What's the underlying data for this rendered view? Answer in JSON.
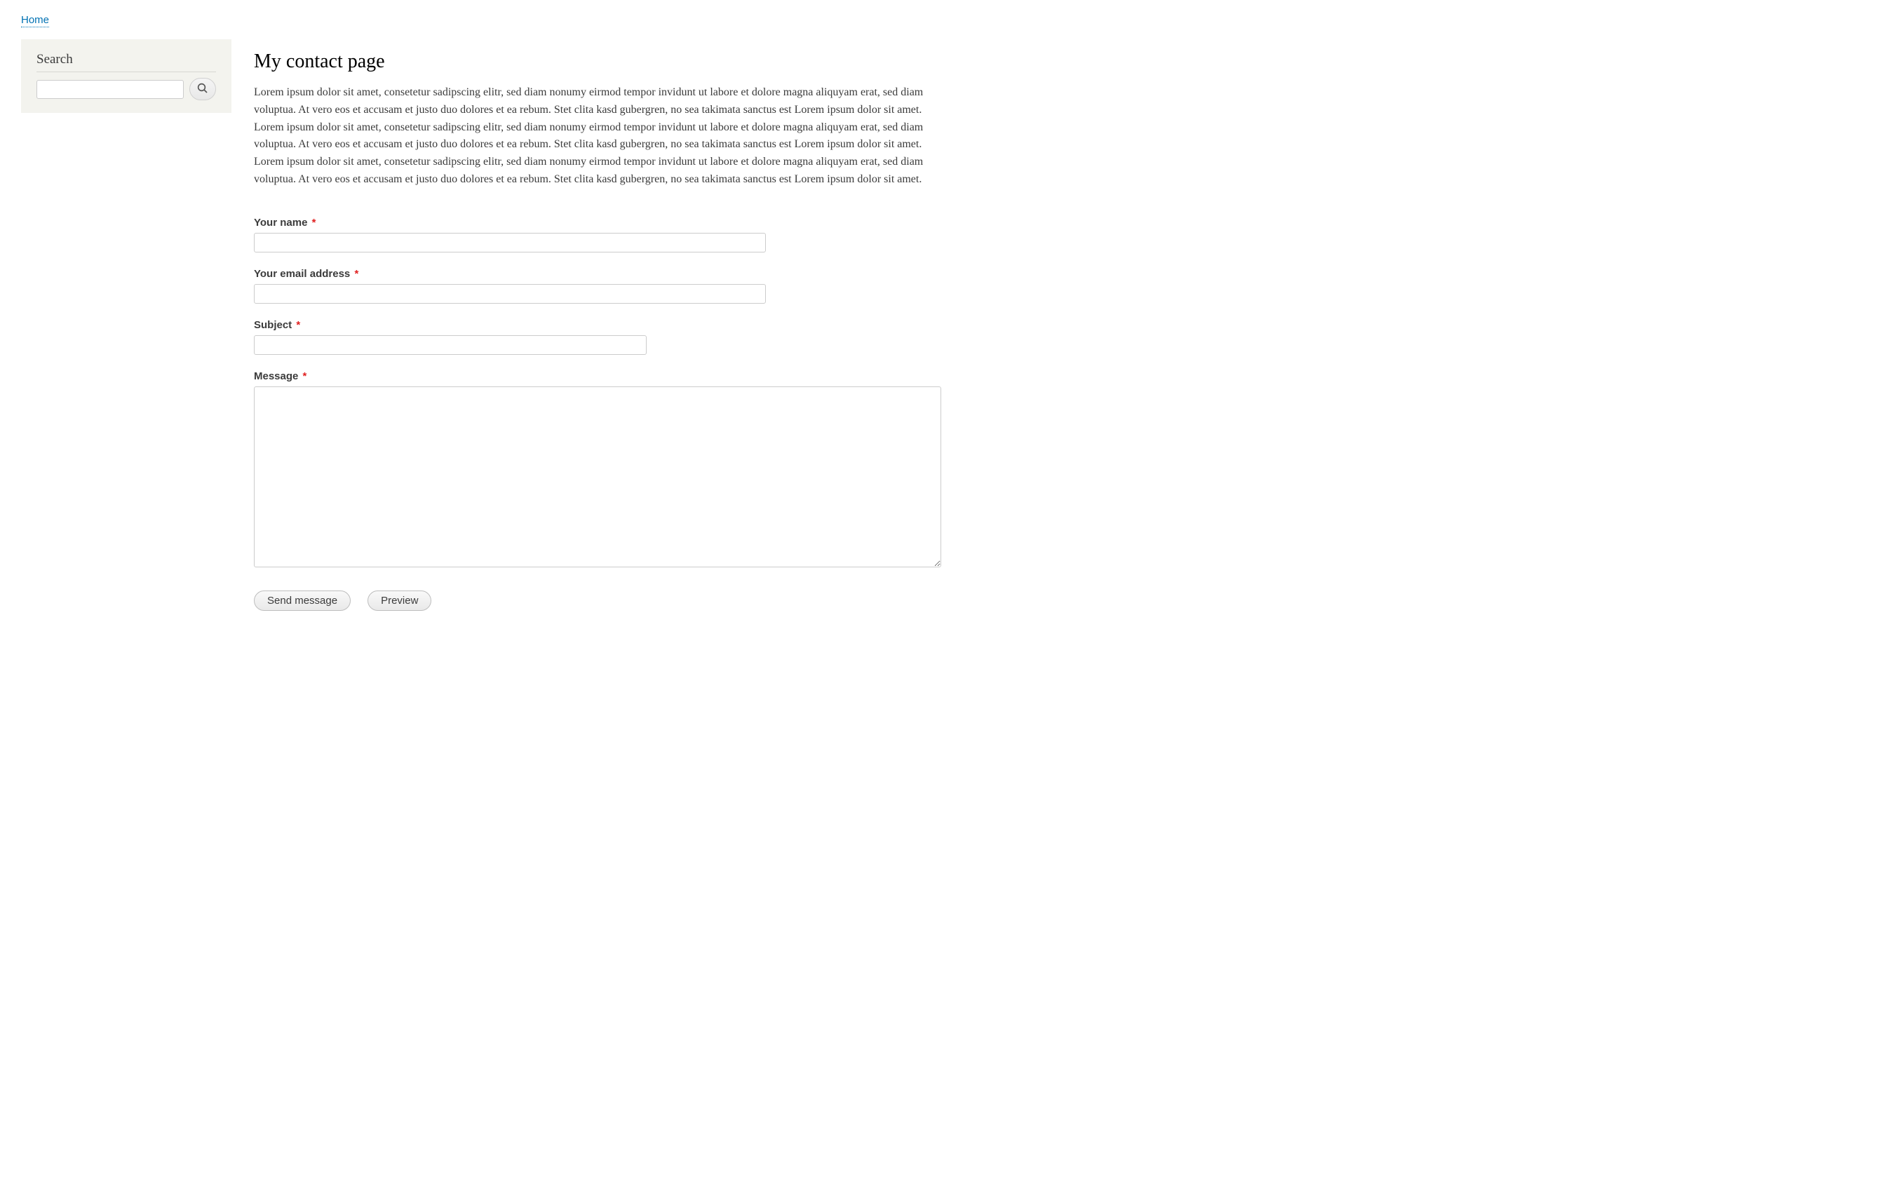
{
  "breadcrumb": {
    "home": "Home"
  },
  "sidebar": {
    "search": {
      "title": "Search",
      "value": "",
      "placeholder": ""
    }
  },
  "main": {
    "title": "My contact page",
    "intro": "Lorem ipsum dolor sit amet, consetetur sadipscing elitr, sed diam nonumy eirmod tempor invidunt ut labore et dolore magna aliquyam erat, sed diam voluptua. At vero eos et accusam et justo duo dolores et ea rebum. Stet clita kasd gubergren, no sea takimata sanctus est Lorem ipsum dolor sit amet. Lorem ipsum dolor sit amet, consetetur sadipscing elitr, sed diam nonumy eirmod tempor invidunt ut labore et dolore magna aliquyam erat, sed diam voluptua. At vero eos et accusam et justo duo dolores et ea rebum. Stet clita kasd gubergren, no sea takimata sanctus est Lorem ipsum dolor sit amet. Lorem ipsum dolor sit amet, consetetur sadipscing elitr, sed diam nonumy eirmod tempor invidunt ut labore et dolore magna aliquyam erat, sed diam voluptua. At vero eos et accusam et justo duo dolores et ea rebum. Stet clita kasd gubergren, no sea takimata sanctus est Lorem ipsum dolor sit amet."
  },
  "form": {
    "name": {
      "label": "Your name",
      "value": "",
      "required": true
    },
    "email": {
      "label": "Your email address",
      "value": "",
      "required": true
    },
    "subject": {
      "label": "Subject",
      "value": "",
      "required": true
    },
    "message": {
      "label": "Message",
      "value": "",
      "required": true
    },
    "actions": {
      "send": "Send message",
      "preview": "Preview"
    },
    "required_mark": "*"
  }
}
